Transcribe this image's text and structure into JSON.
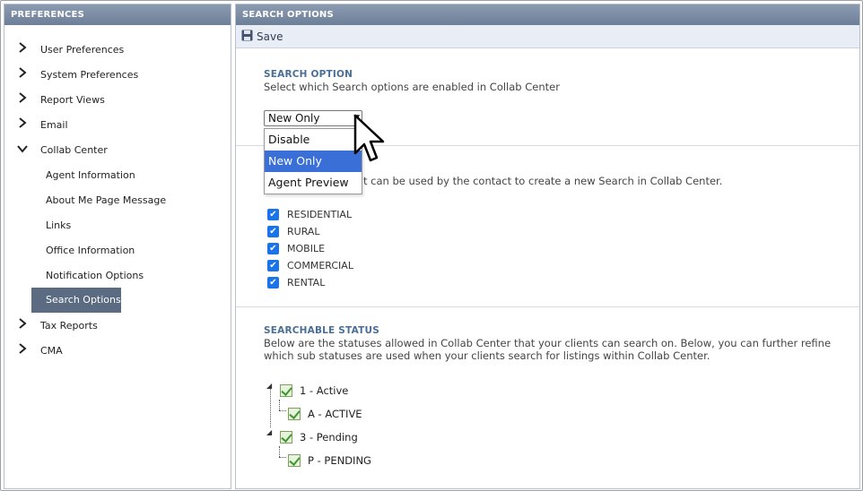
{
  "left_panel": {
    "title": "PREFERENCES",
    "items": [
      {
        "label": "User Preferences",
        "icon": "chevron-right-icon"
      },
      {
        "label": "System Preferences",
        "icon": "chevron-right-icon"
      },
      {
        "label": "Report Views",
        "icon": "chevron-right-icon"
      },
      {
        "label": "Email",
        "icon": "chevron-right-icon"
      },
      {
        "label": "Collab Center",
        "icon": "chevron-down-icon"
      },
      {
        "label": "Agent Information"
      },
      {
        "label": "About Me Page Message"
      },
      {
        "label": "Links"
      },
      {
        "label": "Office Information"
      },
      {
        "label": "Notification Options"
      },
      {
        "label": "Search Options",
        "active": true
      },
      {
        "label": "Tax Reports",
        "icon": "chevron-right-icon"
      },
      {
        "label": "CMA",
        "icon": "chevron-right-icon"
      }
    ]
  },
  "right_panel": {
    "title": "SEARCH OPTIONS",
    "toolbar": {
      "save_label": "Save",
      "save_icon": "floppy-disk-icon"
    },
    "search_option": {
      "title": "SEARCH OPTION",
      "description": "Select which Search options are enabled in Collab Center",
      "selected": "New Only",
      "options": [
        "Disable",
        "New Only",
        "Agent Preview"
      ]
    },
    "property_types": {
      "description_visible": "t can be used by the contact to create a new Search in Collab Center.",
      "items": [
        {
          "label": "RESIDENTIAL",
          "checked": true
        },
        {
          "label": "RURAL",
          "checked": true
        },
        {
          "label": "MOBILE",
          "checked": true
        },
        {
          "label": "COMMERCIAL",
          "checked": true
        },
        {
          "label": "RENTAL",
          "checked": true
        }
      ]
    },
    "searchable_status": {
      "title": "SEARCHABLE STATUS",
      "description": "Below are the statuses allowed in Collab Center that your clients can search on. Below, you can further refine which sub statuses are used when your clients search for listings within Collab Center.",
      "tree": [
        {
          "label": "1 - Active",
          "checked": true,
          "children": [
            {
              "label": "A - ACTIVE",
              "checked": true
            }
          ]
        },
        {
          "label": "3 - Pending",
          "checked": true,
          "children": [
            {
              "label": "P - PENDING",
              "checked": true
            }
          ]
        }
      ]
    }
  },
  "colors": {
    "header": "#6d7f98",
    "active_nav": "#5b6b82",
    "section_title": "#4a6f96",
    "select_highlight": "#3a6fd8",
    "checkbox": "#1a73e8"
  }
}
